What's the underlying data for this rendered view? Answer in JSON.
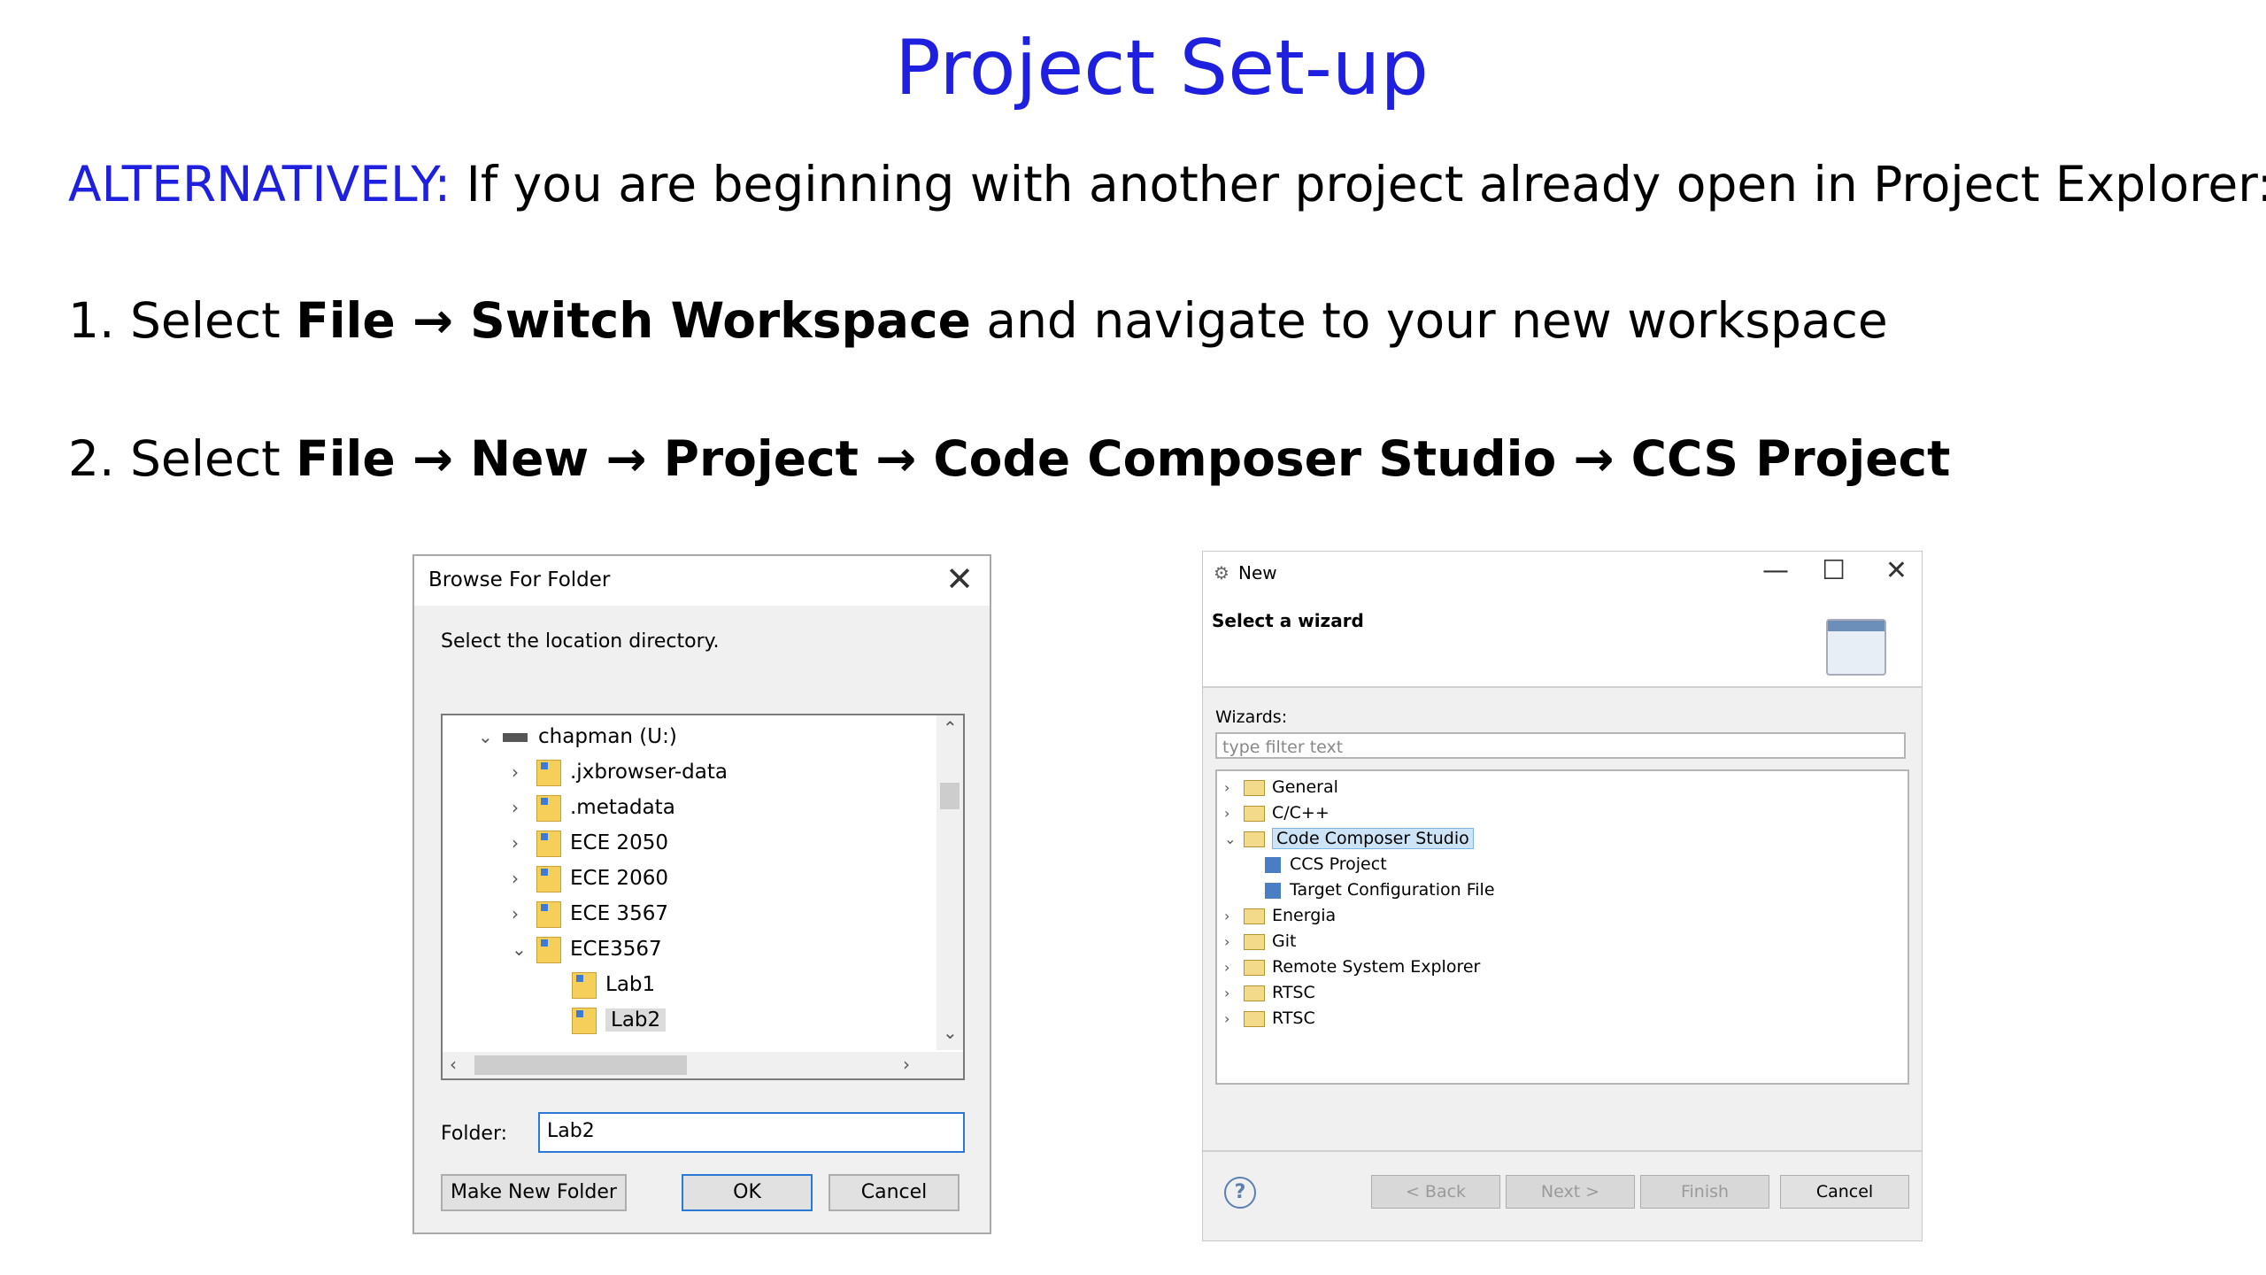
{
  "slide": {
    "title": "Project Set-up",
    "intro_highlight": "ALTERNATIVELY:",
    "intro_text": " If you are beginning with another project already open in Project Explorer:",
    "step1": {
      "prefix": "1.  Select ",
      "file": "File",
      "arrow": " → ",
      "switch": "Switch Workspace",
      "suffix": " and navigate to your new workspace"
    },
    "step2": {
      "prefix": "2. Select ",
      "file": "File",
      "arrow": " → ",
      "new": "New",
      "project": "Project",
      "ccs": "Code Composer Studio",
      "ccs_project": "CCS Project"
    }
  },
  "browse_dialog": {
    "title": "Browse For Folder",
    "close": "✕",
    "prompt": "Select the location directory.",
    "tree": [
      {
        "label": "chapman (U:)",
        "chev": "⌄",
        "type": "drive"
      },
      {
        "label": ".jxbrowser-data",
        "chev": "›",
        "type": "folder"
      },
      {
        "label": ".metadata",
        "chev": "›",
        "type": "folder"
      },
      {
        "label": "ECE 2050",
        "chev": "›",
        "type": "folder"
      },
      {
        "label": "ECE 2060",
        "chev": "›",
        "type": "folder"
      },
      {
        "label": "ECE 3567",
        "chev": "›",
        "type": "folder"
      },
      {
        "label": "ECE3567",
        "chev": "⌄",
        "type": "folder"
      },
      {
        "label": "Lab1",
        "chev": "",
        "type": "folder"
      },
      {
        "label": "Lab2",
        "chev": "",
        "type": "folder",
        "selected": true
      }
    ],
    "folder_label": "Folder:",
    "folder_value": "Lab2",
    "make_new_folder": "Make New Folder",
    "ok": "OK",
    "cancel": "Cancel"
  },
  "wizard_dialog": {
    "title": "New",
    "minimize": "—",
    "maximize": "☐",
    "close": "✕",
    "heading": "Select a wizard",
    "wizards_label": "Wizards:",
    "filter_placeholder": "type filter text",
    "items": [
      {
        "label": "General",
        "chev": "›",
        "level": 0,
        "icon": "folder"
      },
      {
        "label": "C/C++",
        "chev": "›",
        "level": 0,
        "icon": "folder"
      },
      {
        "label": "Code Composer Studio",
        "chev": "⌄",
        "level": 0,
        "icon": "folder",
        "highlight": true
      },
      {
        "label": "CCS Project",
        "chev": "",
        "level": 1,
        "icon": "project"
      },
      {
        "label": "Target Configuration File",
        "chev": "",
        "level": 1,
        "icon": "project"
      },
      {
        "label": "Energia",
        "chev": "›",
        "level": 0,
        "icon": "folder"
      },
      {
        "label": "Git",
        "chev": "›",
        "level": 0,
        "icon": "folder"
      },
      {
        "label": "Remote System Explorer",
        "chev": "›",
        "level": 0,
        "icon": "folder"
      },
      {
        "label": "RTSC",
        "chev": "›",
        "level": 0,
        "icon": "folder"
      },
      {
        "label": "RTSC",
        "chev": "›",
        "level": 0,
        "icon": "folder"
      }
    ],
    "help": "?",
    "back": "< Back",
    "next": "Next >",
    "finish": "Finish",
    "cancel": "Cancel"
  }
}
